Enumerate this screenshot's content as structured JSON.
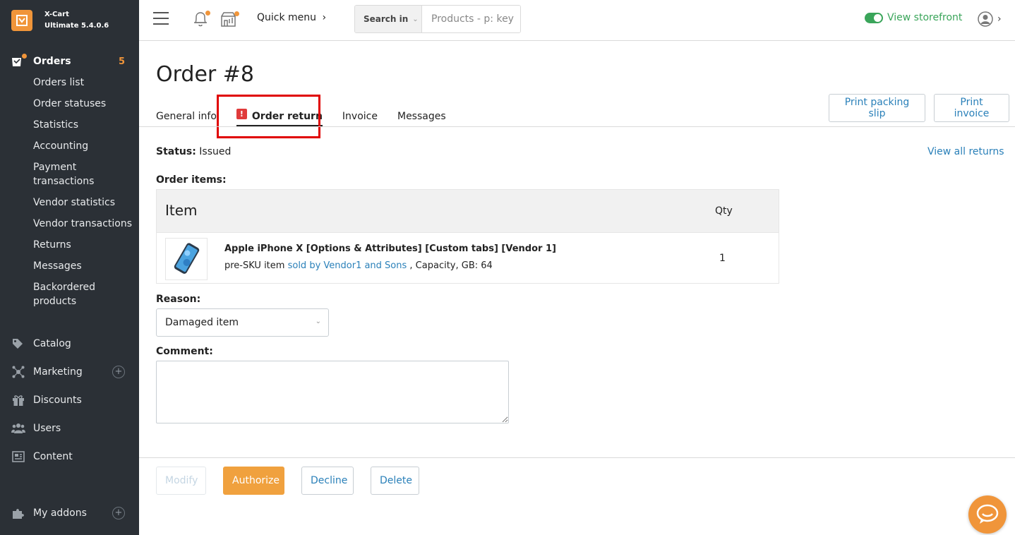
{
  "brand": {
    "name": "X-Cart",
    "edition": "Ultimate 5.4.0.6"
  },
  "sidebar": {
    "orders": {
      "label": "Orders",
      "count": "5",
      "items": [
        {
          "label": "Orders list"
        },
        {
          "label": "Order statuses"
        },
        {
          "label": "Statistics"
        },
        {
          "label": "Accounting"
        },
        {
          "label": "Payment transactions"
        },
        {
          "label": "Vendor statistics"
        },
        {
          "label": "Vendor transactions"
        },
        {
          "label": "Returns"
        },
        {
          "label": "Messages"
        },
        {
          "label": "Backordered products"
        }
      ]
    },
    "catalog": "Catalog",
    "marketing": "Marketing",
    "discounts": "Discounts",
    "users": "Users",
    "content": "Content",
    "my_addons": "My addons"
  },
  "topbar": {
    "quick_menu": "Quick menu",
    "search_in": "Search in",
    "search_placeholder": "Products - p: key",
    "view_storefront": "View storefront"
  },
  "page": {
    "title": "Order #8",
    "tabs": [
      {
        "label": "General info"
      },
      {
        "label": "Order return"
      },
      {
        "label": "Invoice"
      },
      {
        "label": "Messages"
      }
    ],
    "print_packing_slip": "Print packing slip",
    "print_invoice": "Print invoice",
    "status_label": "Status:",
    "status_value": "Issued",
    "view_all_returns": "View all returns",
    "order_items_label": "Order items:",
    "table": {
      "col_item": "Item",
      "col_qty": "Qty",
      "rows": [
        {
          "name": "Apple iPhone X [Options & Attributes] [Custom tabs] [Vendor 1]",
          "sku": "pre-SKU item",
          "vendor": "sold by Vendor1 and Sons",
          "attributes": ", Capacity, GB: 64",
          "qty": "1"
        }
      ]
    },
    "reason_label": "Reason:",
    "reason_value": "Damaged item",
    "comment_label": "Comment:",
    "comment_value": ""
  },
  "actions": {
    "modify": "Modify",
    "authorize": "Authorize",
    "decline": "Decline",
    "delete": "Delete"
  },
  "colors": {
    "accent": "#f0953a",
    "link": "#2a80b9",
    "sidebar_bg": "#2b3036",
    "storefront_green": "#3aa55a",
    "alert_red": "#e03b3b"
  }
}
